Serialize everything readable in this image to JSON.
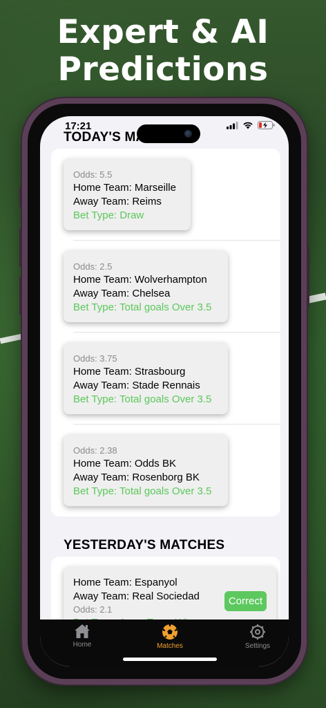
{
  "hero": {
    "line1": "Expert & AI",
    "line2": "Predictions"
  },
  "status_bar": {
    "time": "17:21"
  },
  "sections": {
    "today_title": "TODAY'S MATCHES",
    "yesterday_title": "YESTERDAY'S MATCHES"
  },
  "today_matches": [
    {
      "odds": "Odds: 5.5",
      "home": "Home Team: Marseille",
      "away": "Away Team: Reims",
      "bet": "Bet Type: Draw"
    },
    {
      "odds": "Odds: 2.5",
      "home": "Home Team: Wolverhampton",
      "away": "Away Team: Chelsea",
      "bet": "Bet Type: Total goals Over 3.5"
    },
    {
      "odds": "Odds: 3.75",
      "home": "Home Team: Strasbourg",
      "away": "Away Team: Stade Rennais",
      "bet": "Bet Type: Total goals Over 3.5"
    },
    {
      "odds": "Odds: 2.38",
      "home": "Home Team: Odds BK",
      "away": "Away Team: Rosenborg BK",
      "bet": "Bet Type: Total goals Over 3.5"
    }
  ],
  "yesterday_matches": [
    {
      "home": "Home Team: Espanyol",
      "away": "Away Team: Real Sociedad",
      "odds": "Odds: 2.1",
      "bet": "Bet Type: Away Team Win",
      "result": "Correct"
    }
  ],
  "tabs": [
    {
      "label": "Home",
      "icon": "home-icon",
      "active": false
    },
    {
      "label": "Matches",
      "icon": "soccer-ball-icon",
      "active": true
    },
    {
      "label": "Settings",
      "icon": "gear-icon",
      "active": false
    }
  ],
  "colors": {
    "accent": "#f0a030",
    "bet_green": "#5ac85a",
    "badge_green": "#5cc85e",
    "phone_frame": "#5b3f57"
  }
}
